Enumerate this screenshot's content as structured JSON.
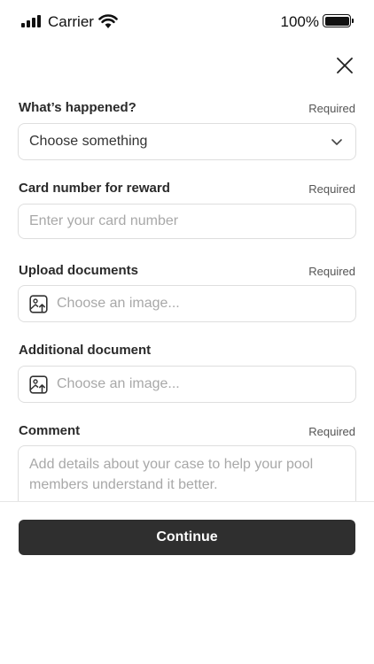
{
  "status_bar": {
    "carrier": "Carrier",
    "battery": "100%"
  },
  "form": {
    "happened": {
      "label": "What’s happened?",
      "required": "Required",
      "value": "Choose something"
    },
    "card": {
      "label": "Card number for reward",
      "required": "Required",
      "placeholder": "Enter your card number"
    },
    "upload": {
      "label": "Upload documents",
      "required": "Required",
      "placeholder": "Choose an image..."
    },
    "additional": {
      "label": "Additional document",
      "placeholder": "Choose an image..."
    },
    "comment": {
      "label": "Comment",
      "required": "Required",
      "placeholder": "Add details about your case to help your pool members understand it better."
    }
  },
  "actions": {
    "continue": "Continue"
  },
  "colors": {
    "primary_button": "#2f2f2f",
    "border": "#dedede",
    "placeholder": "#a8a8a8"
  }
}
